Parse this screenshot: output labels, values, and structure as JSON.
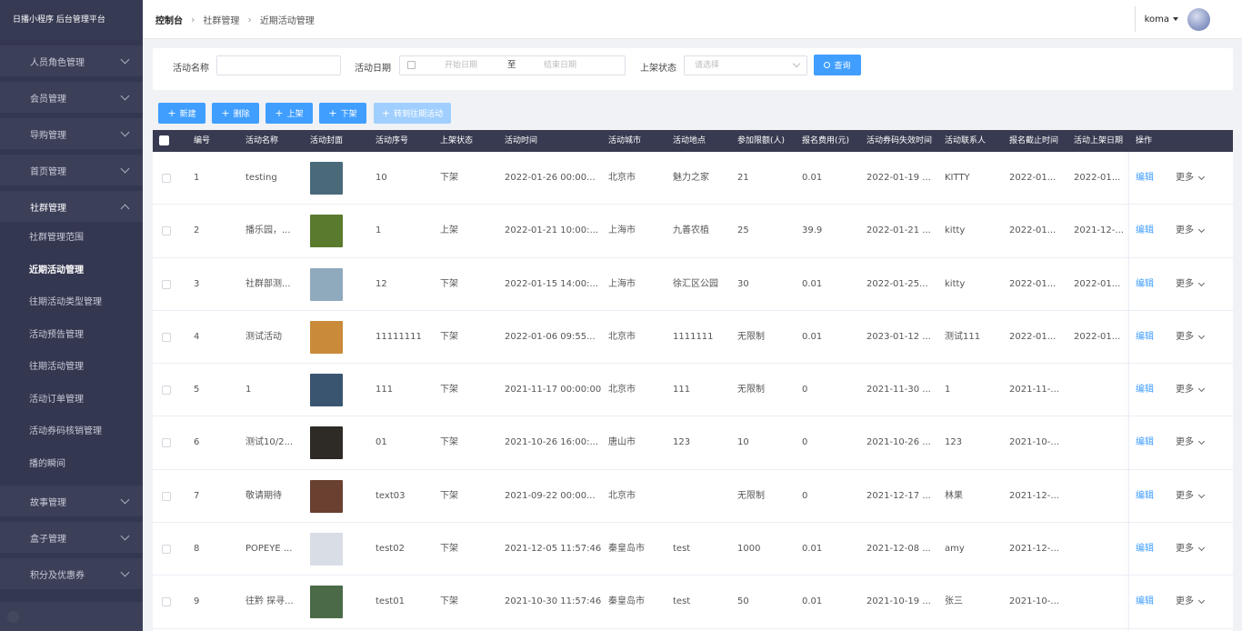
{
  "sidebar": {
    "brand": "日播小程序 后台管理平台",
    "groups_top": [
      {
        "label": "人员角色管理"
      },
      {
        "label": "会员管理"
      },
      {
        "label": "导购管理"
      },
      {
        "label": "首页管理"
      }
    ],
    "open_group": {
      "label": "社群管理"
    },
    "sub_items": [
      {
        "label": "社群管理范围"
      },
      {
        "label": "近期活动管理"
      },
      {
        "label": "往期活动类型管理"
      },
      {
        "label": "活动预告管理"
      },
      {
        "label": "往期活动管理"
      },
      {
        "label": "活动订单管理"
      },
      {
        "label": "活动券码核销管理"
      },
      {
        "label": "播的瞬间"
      }
    ],
    "groups_bottom": [
      {
        "label": "故事管理"
      },
      {
        "label": "盒子管理"
      },
      {
        "label": "积分及优惠券"
      }
    ]
  },
  "header": {
    "breadcrumb": [
      "控制台",
      "社群管理",
      "近期活动管理"
    ],
    "username": "koma"
  },
  "filter": {
    "name_label": "活动名称",
    "date_label": "活动日期",
    "start_placeholder": "开始日期",
    "range_to": "至",
    "end_placeholder": "结束日期",
    "status_label": "上架状态",
    "status_placeholder": "请选择",
    "query_label": "查询"
  },
  "toolbar": {
    "new_label": "新建",
    "delete_label": "删除",
    "on_label": "上架",
    "off_label": "下架",
    "transfer_label": "转到往期活动"
  },
  "table": {
    "headers": [
      "编号",
      "活动名称",
      "活动封面",
      "活动序号",
      "上架状态",
      "活动时间",
      "活动城市",
      "活动地点",
      "参加限额(人)",
      "报名费用(元)",
      "活动券码失效时间",
      "活动联系人",
      "报名截止时间",
      "活动上架日期",
      "操作"
    ],
    "edit_label": "编辑",
    "more_label": "更多",
    "rows": [
      {
        "no": "1",
        "name": "testing",
        "cover": "#4a6a7a",
        "seq": "10",
        "status": "下架",
        "time": "2022-01-26 00:00...",
        "city": "北京市",
        "place": "魅力之家",
        "limit": "21",
        "fee": "0.01",
        "expire": "2022-01-19 ...",
        "contact": "KITTY",
        "deadline": "2022-01...",
        "shelf": "2022-01..."
      },
      {
        "no": "2",
        "name": "播乐园，...",
        "cover": "#5a7a2e",
        "seq": "1",
        "status": "上架",
        "time": "2022-01-21 10:00:...",
        "city": "上海市",
        "place": "九善农植",
        "limit": "25",
        "fee": "39.9",
        "expire": "2022-01-21 ...",
        "contact": "kitty",
        "deadline": "2022-01...",
        "shelf": "2021-12-..."
      },
      {
        "no": "3",
        "name": "社群部测...",
        "cover": "#8fa9bd",
        "seq": "12",
        "status": "下架",
        "time": "2022-01-15 14:00:...",
        "city": "上海市",
        "place": "徐汇区公园",
        "limit": "30",
        "fee": "0.01",
        "expire": "2022-01-25...",
        "contact": "kitty",
        "deadline": "2022-01...",
        "shelf": "2022-01..."
      },
      {
        "no": "4",
        "name": "测试活动",
        "cover": "#c98a3a",
        "seq": "11111111",
        "status": "下架",
        "time": "2022-01-06 09:55...",
        "city": "北京市",
        "place": "1111111",
        "limit": "无限制",
        "fee": "0.01",
        "expire": "2023-01-12 ...",
        "contact": "测试111",
        "deadline": "2022-01...",
        "shelf": "2022-01..."
      },
      {
        "no": "5",
        "name": "1",
        "cover": "#3a5570",
        "seq": "111",
        "status": "下架",
        "time": "2021-11-17 00:00:00",
        "city": "北京市",
        "place": "111",
        "limit": "无限制",
        "fee": "0",
        "expire": "2021-11-30 ...",
        "contact": "1",
        "deadline": "2021-11-...",
        "shelf": ""
      },
      {
        "no": "6",
        "name": "测试10/2...",
        "cover": "#2e2a26",
        "seq": "01",
        "status": "下架",
        "time": "2021-10-26 16:00:...",
        "city": "唐山市",
        "place": "123",
        "limit": "10",
        "fee": "0",
        "expire": "2021-10-26 ...",
        "contact": "123",
        "deadline": "2021-10-...",
        "shelf": ""
      },
      {
        "no": "7",
        "name": "敬请期待",
        "cover": "#6a4030",
        "seq": "text03",
        "status": "下架",
        "time": "2021-09-22 00:00...",
        "city": "北京市",
        "place": "",
        "limit": "无限制",
        "fee": "0",
        "expire": "2021-12-17 ...",
        "contact": "林果",
        "deadline": "2021-12-...",
        "shelf": ""
      },
      {
        "no": "8",
        "name": "POPEYE ...",
        "cover": "#d9dde6",
        "seq": "test02",
        "status": "下架",
        "time": "2021-12-05 11:57:46",
        "city": "秦皇岛市",
        "place": "test",
        "limit": "1000",
        "fee": "0.01",
        "expire": "2021-12-08 ...",
        "contact": "amy",
        "deadline": "2021-12-...",
        "shelf": ""
      },
      {
        "no": "9",
        "name": "往黔 探寻...",
        "cover": "#4a6a48",
        "seq": "test01",
        "status": "下架",
        "time": "2021-10-30 11:57:46",
        "city": "秦皇岛市",
        "place": "test",
        "limit": "50",
        "fee": "0.01",
        "expire": "2021-10-19 ...",
        "contact": "张三",
        "deadline": "2021-10-...",
        "shelf": ""
      }
    ]
  }
}
